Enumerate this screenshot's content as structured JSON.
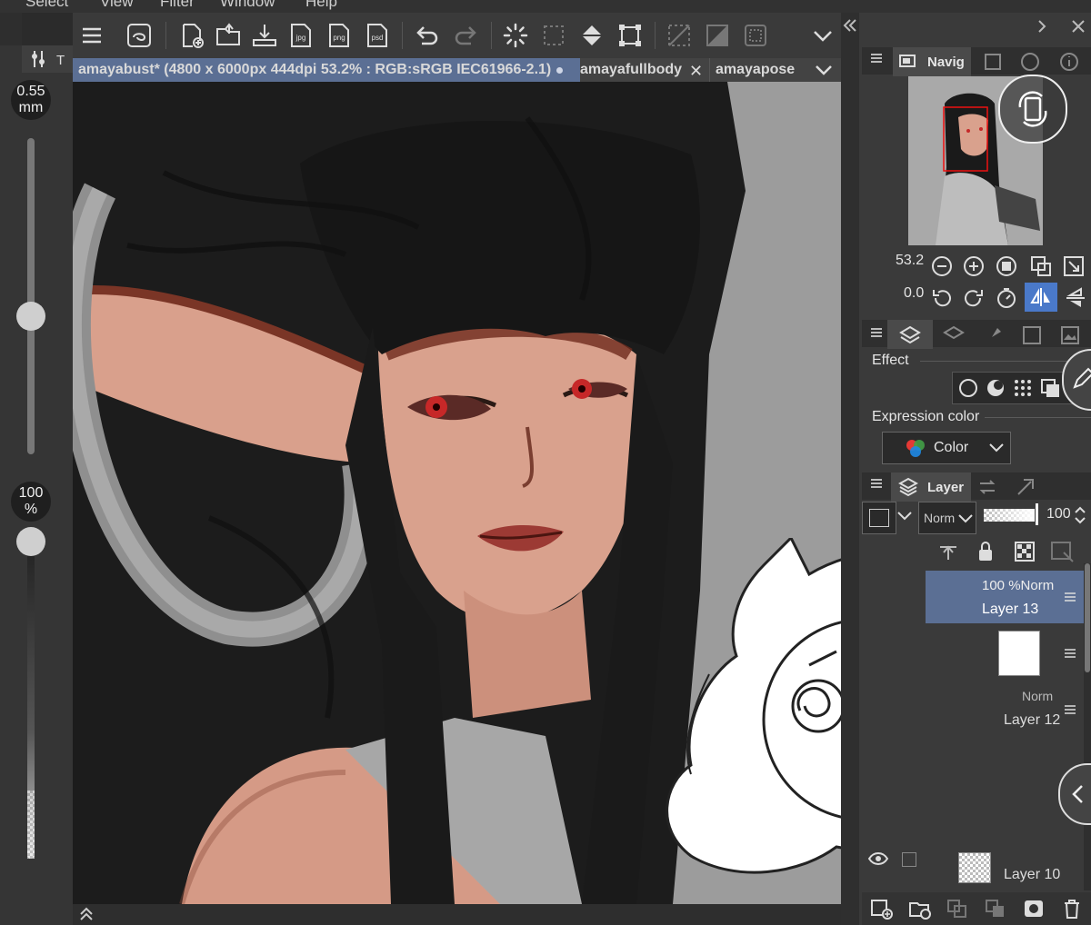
{
  "menu": [
    "Select",
    "View",
    "Filter",
    "Window",
    "Help"
  ],
  "tool_panel": {
    "tab_label": "T",
    "brush_size": "0.55",
    "brush_size_unit": "mm",
    "opacity": "100",
    "opacity_unit": "%",
    "brush_size_level": 0.35,
    "opacity_level": 1.0
  },
  "tabs": [
    {
      "label": "amayabust* (4800 x 6000px 444dpi 53.2% : RGB:sRGB IEC61966-2.1)",
      "active": true
    },
    {
      "label": "amayafullbody",
      "active": false
    },
    {
      "label": "amayapose",
      "active": false
    }
  ],
  "navigator": {
    "title": "Navig",
    "zoom": "53.2",
    "rotation": "0.0"
  },
  "effect_panel": {
    "effect_label": "Effect",
    "expression_label": "Expression color",
    "expression_value": "Color"
  },
  "layer_panel": {
    "title": "Layer",
    "blend_mode": "Norm",
    "opacity": "100",
    "layers": [
      {
        "opacity_mode": "100 %Norm",
        "name": "Layer 13",
        "selected": true
      },
      {
        "opacity_mode": "Norm",
        "name": "Layer 12",
        "selected": false
      },
      {
        "opacity_mode": "",
        "name": "Layer 10",
        "selected": false
      }
    ]
  },
  "colors": {
    "accent": "#4a79c9",
    "tab_active": "#5b6f94",
    "panel": "#3a3a3a",
    "canvas": "#9b9b9b",
    "skin": "#d99a84",
    "hair": "#1a1a1a",
    "eye": "#c62828"
  }
}
